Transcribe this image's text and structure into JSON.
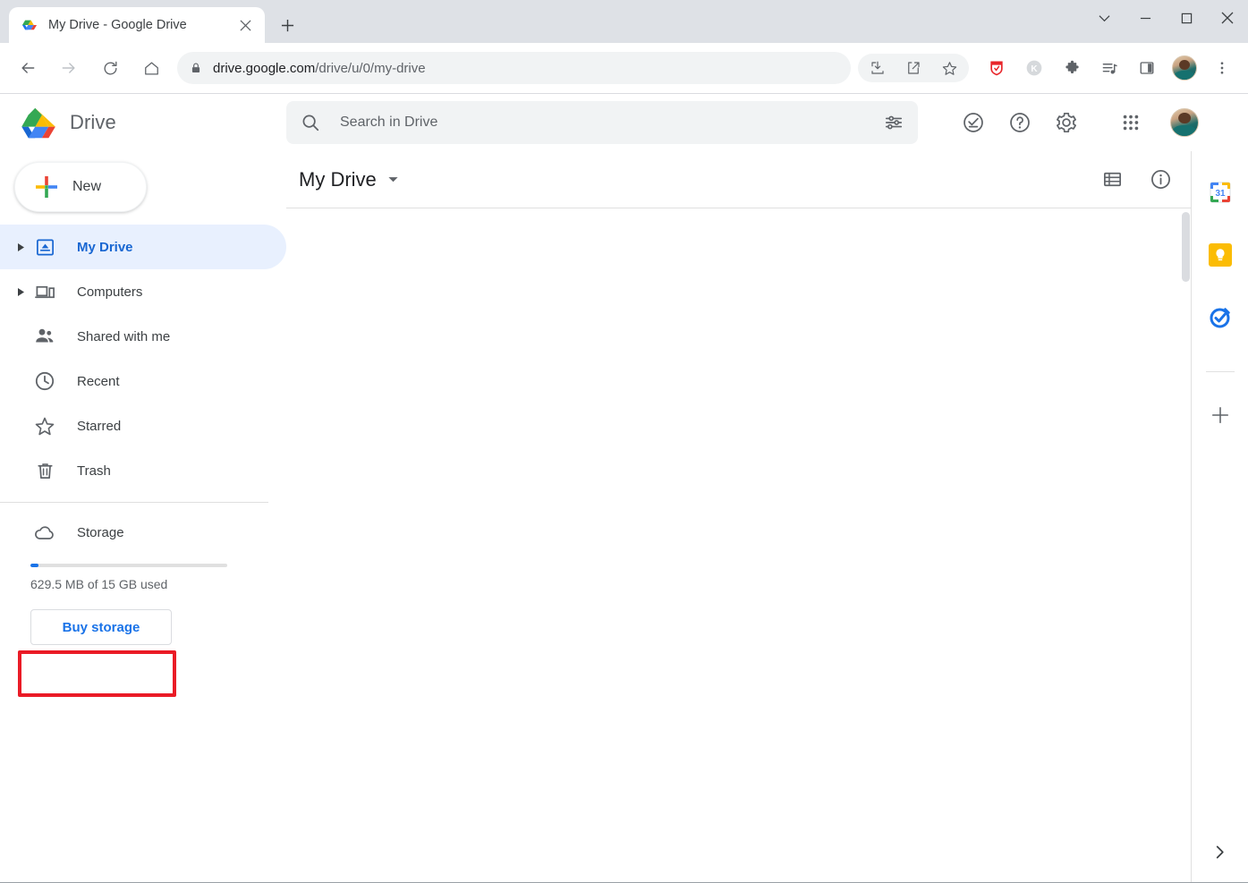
{
  "browser": {
    "tab": {
      "title": "My Drive - Google Drive",
      "favicon": "google-drive-favicon",
      "close_label": "×"
    },
    "new_tab_label": "+",
    "window_controls": {
      "tab_search": "tab-search-chevron",
      "minimize": "minimize",
      "maximize": "maximize",
      "close": "close"
    },
    "nav": {
      "back": "back-arrow",
      "forward": "forward-arrow",
      "reload": "reload",
      "home": "home"
    },
    "omnibox": {
      "lock": "lock-icon",
      "url_host": "drive.google.com",
      "url_path": "/drive/u/0/my-drive",
      "url_full": "drive.google.com/drive/u/0/my-drive"
    },
    "toolbar_icons": [
      {
        "name": "install-app-icon"
      },
      {
        "name": "share-icon"
      },
      {
        "name": "bookmark-star-icon"
      },
      {
        "name": "red-extension-icon",
        "color": "#e8252a"
      },
      {
        "name": "k-extension-icon",
        "label": "K",
        "color": "#9aa0a6"
      },
      {
        "name": "extensions-puzzle-icon"
      },
      {
        "name": "media-playlist-icon"
      },
      {
        "name": "side-panel-icon"
      },
      {
        "name": "profile-avatar"
      },
      {
        "name": "chrome-menu-icon"
      }
    ]
  },
  "drive": {
    "brand": {
      "logo": "google-drive-logo",
      "name": "Drive"
    },
    "search": {
      "placeholder": "Search in Drive",
      "value": "",
      "search_icon": "search-icon",
      "tune_icon": "tune-filter-icon"
    },
    "header_actions": [
      {
        "name": "support-check-icon"
      },
      {
        "name": "help-question-icon"
      },
      {
        "name": "settings-gear-icon"
      },
      {
        "name": "google-apps-grid-icon"
      }
    ],
    "new_button": {
      "label": "New",
      "icon": "plus-colored-icon"
    },
    "sidebar": {
      "items": [
        {
          "label": "My Drive",
          "icon": "my-drive-icon",
          "active": true,
          "expandable": true
        },
        {
          "label": "Computers",
          "icon": "computers-icon",
          "active": false,
          "expandable": true
        },
        {
          "label": "Shared with me",
          "icon": "shared-people-icon",
          "active": false,
          "expandable": false
        },
        {
          "label": "Recent",
          "icon": "clock-icon",
          "active": false,
          "expandable": false
        },
        {
          "label": "Starred",
          "icon": "star-icon",
          "active": false,
          "expandable": false
        },
        {
          "label": "Trash",
          "icon": "trash-icon",
          "active": false,
          "expandable": false,
          "highlighted": true
        }
      ],
      "storage": {
        "label": "Storage",
        "icon": "cloud-icon",
        "used_text": "629.5 MB of 15 GB used",
        "percent": 4,
        "buy_button": "Buy storage"
      }
    },
    "main": {
      "breadcrumb": "My Drive",
      "breadcrumb_caret": "chevron-down-icon",
      "view_icons": [
        {
          "name": "list-view-icon"
        },
        {
          "name": "info-details-icon"
        }
      ]
    },
    "rail": {
      "apps": [
        {
          "name": "google-calendar-icon",
          "label": "31"
        },
        {
          "name": "google-keep-icon"
        },
        {
          "name": "google-tasks-icon"
        }
      ],
      "add_label": "+",
      "expand_icon": "chevron-right-icon"
    }
  },
  "colors": {
    "accent_blue": "#1a73e8",
    "active_pill": "#e8f0fe",
    "active_text": "#1967d2",
    "highlight_red": "#ea1b26",
    "text_primary": "#202124",
    "text_secondary": "#5f6368"
  }
}
